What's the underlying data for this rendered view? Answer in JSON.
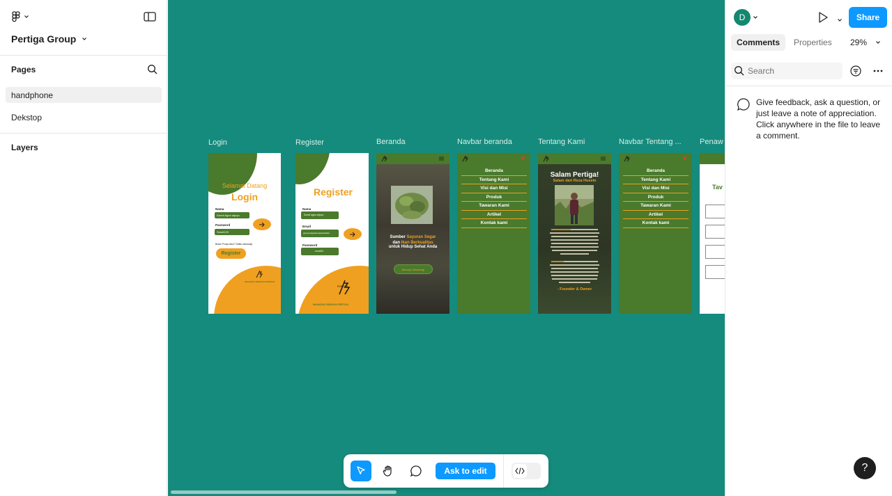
{
  "app": {
    "project_name": "Pertiga Group",
    "pages_label": "Pages",
    "pages": [
      {
        "label": "handphone",
        "selected": true
      },
      {
        "label": "Dekstop",
        "selected": false
      }
    ],
    "layers_label": "Layers"
  },
  "header": {
    "avatar_letter": "D",
    "share_label": "Share"
  },
  "right_panel": {
    "tabs": [
      {
        "label": "Comments",
        "active": true
      },
      {
        "label": "Properties",
        "active": false
      }
    ],
    "zoom": "29%",
    "search_placeholder": "Search",
    "hint": "Give feedback, ask a question, or just leave a note of appreciation. Click anywhere in the file to leave a comment."
  },
  "canvas": {
    "frames": [
      {
        "title": "Login"
      },
      {
        "title": "Register"
      },
      {
        "title": "Beranda"
      },
      {
        "title": "Navbar beranda"
      },
      {
        "title": "Tentang Kami"
      },
      {
        "title": "Navbar Tentang ..."
      },
      {
        "title": "Penaw"
      }
    ],
    "login": {
      "greeting": "Selamat Datang",
      "heading": "Login",
      "name_label": "Nama",
      "name_value": "Dondi Agus wijoyo",
      "password_label": "Password",
      "password_value": "Sondi123",
      "no_account": "Belum Punya Akun? Daftar sekarang!",
      "register_btn": "Register",
      "brand": "MAHAESA DWIDAYA PERTIGA"
    },
    "register": {
      "heading": "Register",
      "name_label": "Nama",
      "name_value": "Dondi agus wijoyo",
      "email_label": "Email",
      "email_value": "gexyamagasaunpgarstatiata",
      "password_label": "Password",
      "password_value": "sundi12",
      "brand_mark": "PERTIGA",
      "brand": "MAHAESA DWIDAYA PERTIGA"
    },
    "beranda": {
      "line1_a": "Sumber ",
      "line1_b": "Sayuran Segar",
      "line2_a": "dan ",
      "line2_b": "Ikan Berkualitas",
      "line3": "untuk Hidup Sehat Anda",
      "cta": "Belanja Sekarang!"
    },
    "navbar_items": [
      "Beranda",
      "Tentang Kami",
      "Visi dan Misi",
      "Produk",
      "Tawaran Kami",
      "Artikel",
      "Kontak kami"
    ],
    "tentang": {
      "title": "Salam Pertiga!",
      "subtitle": "Salam dari Reza Husein",
      "signature": "- Founder & Owner"
    },
    "penawaran": {
      "heading": "Tav"
    }
  },
  "toolbar": {
    "ask_label": "Ask to edit"
  },
  "help_label": "?",
  "colors": {
    "canvas": "#158b7d",
    "accent_blue": "#0d99ff",
    "frame_green": "#4a7a2b",
    "frame_orange": "#f0a020"
  }
}
